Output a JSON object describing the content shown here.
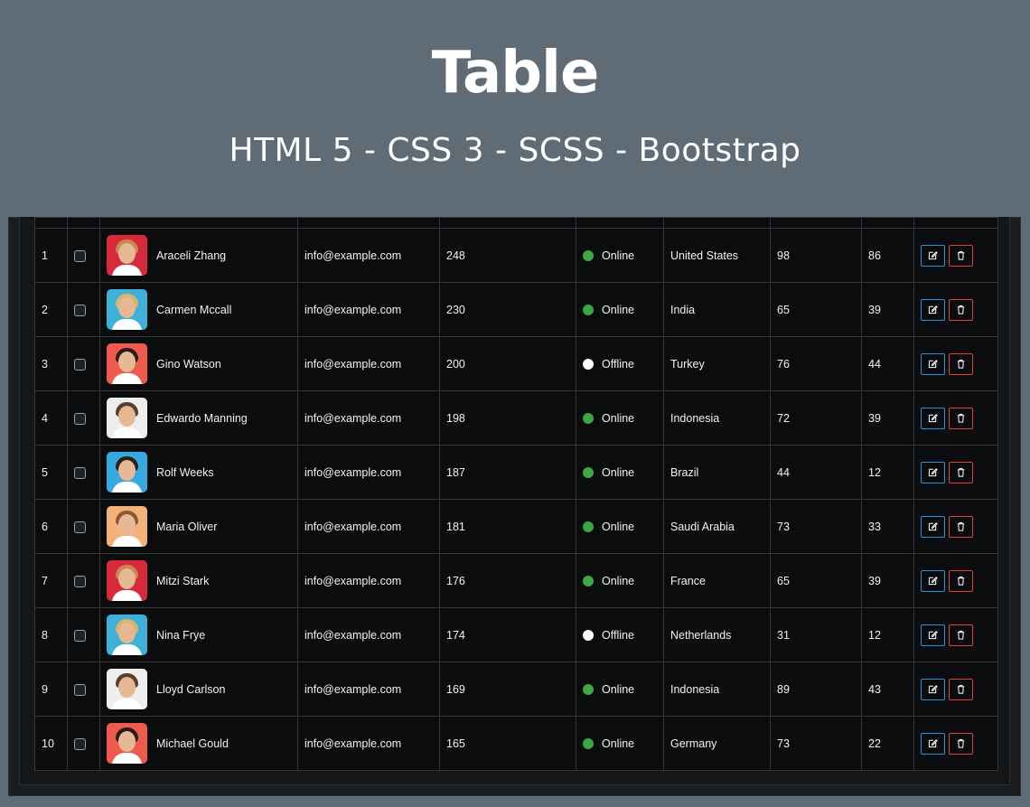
{
  "header": {
    "title": "Table",
    "subtitle": "HTML 5 - CSS 3 - SCSS - Bootstrap"
  },
  "colors": {
    "background": "#5f6b75",
    "table_bg": "#0b0c0d",
    "online": "#3aa845",
    "offline": "#ffffff",
    "edit_border": "#2f8fd4",
    "delete_border": "#e0453a"
  },
  "table": {
    "rows": [
      {
        "num": "1",
        "name": "Araceli Zhang",
        "email": "info@example.com",
        "score": "248",
        "status": "Online",
        "country": "United States",
        "v1": "98",
        "v2": "86",
        "avatar": {
          "bg": "#d62a3a",
          "hair": "#c8894f"
        }
      },
      {
        "num": "2",
        "name": "Carmen Mccall",
        "email": "info@example.com",
        "score": "230",
        "status": "Online",
        "country": "India",
        "v1": "65",
        "v2": "39",
        "avatar": {
          "bg": "#3fb0d8",
          "hair": "#d9b46a"
        }
      },
      {
        "num": "3",
        "name": "Gino Watson",
        "email": "info@example.com",
        "score": "200",
        "status": "Offline",
        "country": "Turkey",
        "v1": "76",
        "v2": "44",
        "avatar": {
          "bg": "#ef5a4f",
          "hair": "#2a1c18"
        }
      },
      {
        "num": "4",
        "name": "Edwardo Manning",
        "email": "info@example.com",
        "score": "198",
        "status": "Online",
        "country": "Indonesia",
        "v1": "72",
        "v2": "39",
        "avatar": {
          "bg": "#eeeeee",
          "hair": "#5a3e2b"
        }
      },
      {
        "num": "5",
        "name": "Rolf Weeks",
        "email": "info@example.com",
        "score": "187",
        "status": "Online",
        "country": "Brazil",
        "v1": "44",
        "v2": "12",
        "avatar": {
          "bg": "#35a9e0",
          "hair": "#2b1f1a"
        }
      },
      {
        "num": "6",
        "name": "Maria Oliver",
        "email": "info@example.com",
        "score": "181",
        "status": "Online",
        "country": "Saudi Arabia",
        "v1": "73",
        "v2": "33",
        "avatar": {
          "bg": "#f2b27a",
          "hair": "#8a5a35"
        }
      },
      {
        "num": "7",
        "name": "Mitzi Stark",
        "email": "info@example.com",
        "score": "176",
        "status": "Online",
        "country": "France",
        "v1": "65",
        "v2": "39",
        "avatar": {
          "bg": "#d62a3a",
          "hair": "#c8894f"
        }
      },
      {
        "num": "8",
        "name": "Nina Frye",
        "email": "info@example.com",
        "score": "174",
        "status": "Offline",
        "country": "Netherlands",
        "v1": "31",
        "v2": "12",
        "avatar": {
          "bg": "#3fb0d8",
          "hair": "#d9b46a"
        }
      },
      {
        "num": "9",
        "name": "Lloyd Carlson",
        "email": "info@example.com",
        "score": "169",
        "status": "Online",
        "country": "Indonesia",
        "v1": "89",
        "v2": "43",
        "avatar": {
          "bg": "#eeeeee",
          "hair": "#5a3e2b"
        }
      },
      {
        "num": "10",
        "name": "Michael Gould",
        "email": "info@example.com",
        "score": "165",
        "status": "Online",
        "country": "Germany",
        "v1": "73",
        "v2": "22",
        "avatar": {
          "bg": "#ef5a4f",
          "hair": "#2a1c18"
        }
      }
    ]
  }
}
